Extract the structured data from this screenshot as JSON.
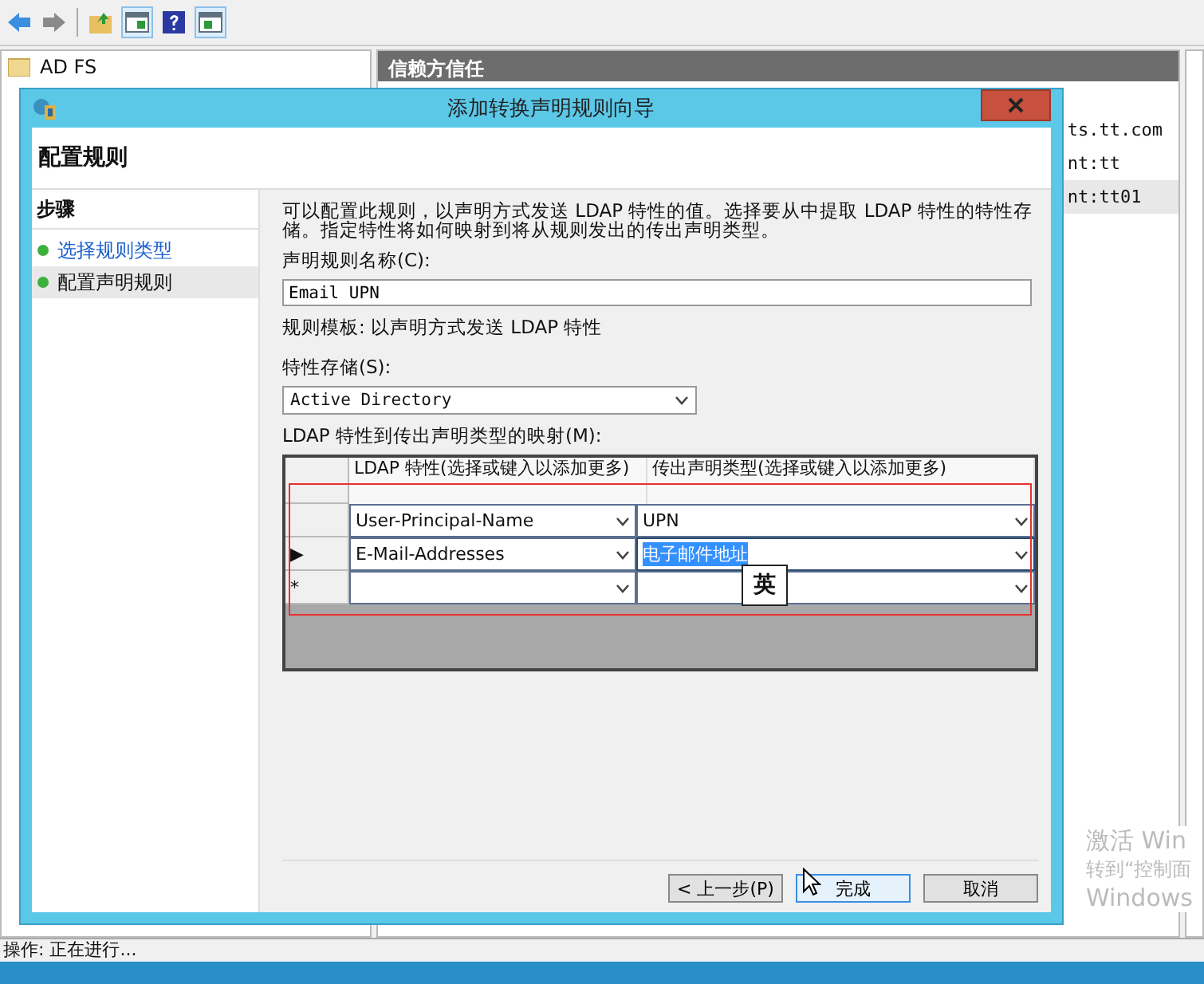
{
  "tree": {
    "items": [
      {
        "label": "AD FS"
      }
    ]
  },
  "center_pane": {
    "title": "信赖方信任",
    "rows": [
      {
        "text": "ts.tt.com",
        "selected": false
      },
      {
        "text": "nt:tt",
        "selected": false
      },
      {
        "text": "nt:tt01",
        "selected": true
      }
    ]
  },
  "dialog": {
    "title": "添加转换声明规则向导",
    "heading": "配置规则",
    "steps_title": "步骤",
    "steps": [
      {
        "label": "选择规则类型",
        "selected": false
      },
      {
        "label": "配置声明规则",
        "selected": true
      }
    ],
    "intro": "可以配置此规则，以声明方式发送 LDAP 特性的值。选择要从中提取 LDAP 特性的特性存储。指定特性将如何映射到将从规则发出的传出声明类型。",
    "name_label": "声明规则名称(C):",
    "name_value": "Email UPN",
    "template": "规则模板: 以声明方式发送 LDAP 特性",
    "store_label": "特性存储(S):",
    "store_value": "Active Directory",
    "mapping_label": "LDAP 特性到传出声明类型的映射(M):",
    "mapping": {
      "columns": [
        "LDAP 特性(选择或键入以添加更多)",
        "传出声明类型(选择或键入以添加更多)"
      ],
      "rows": [
        {
          "attribute": "User-Principal-Name",
          "claim": "UPN",
          "claim_selected": false
        },
        {
          "indicator": "▶",
          "attribute": "E-Mail-Addresses",
          "claim": "电子邮件地址",
          "claim_selected": true
        },
        {
          "indicator": "*",
          "claim_selected": false
        }
      ]
    },
    "buttons": [
      {
        "label": "< 上一步(P)",
        "default": false
      },
      {
        "label": "完成",
        "default": true
      },
      {
        "label": "取消",
        "default": false
      }
    ]
  },
  "ime_indicator": "英",
  "activation_notice": [
    "激活 Win",
    "转到“控制面",
    "Windows"
  ],
  "status_bar": {
    "text": "操作: 正在进行..."
  }
}
